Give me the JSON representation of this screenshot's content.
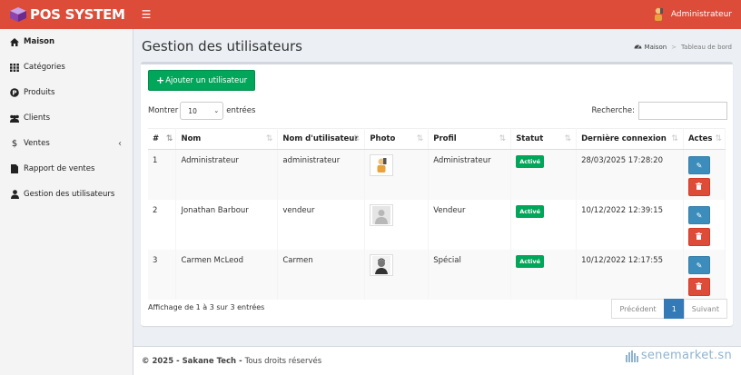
{
  "app": {
    "logo_text": "POS SYSTEM",
    "user_name": "Administrateur"
  },
  "sidebar": {
    "items": [
      {
        "label": "Maison",
        "icon": "home-icon"
      },
      {
        "label": "Catégories",
        "icon": "grid-icon"
      },
      {
        "label": "Produits",
        "icon": "product-hunt-icon"
      },
      {
        "label": "Clients",
        "icon": "users-icon"
      },
      {
        "label": "Ventes",
        "icon": "dollar-icon"
      },
      {
        "label": "Rapport de ventes",
        "icon": "file-icon"
      },
      {
        "label": "Gestion des utilisateurs",
        "icon": "user-icon"
      }
    ]
  },
  "page": {
    "title": "Gestion des utilisateurs",
    "breadcrumb": {
      "home": "Maison",
      "current": "Tableau de bord"
    }
  },
  "toolbar": {
    "add_label": "Ajouter un utilisateur"
  },
  "table_controls": {
    "show_label": "Montrer",
    "length_value": "10",
    "entries_label": "entrées",
    "search_label": "Recherche:",
    "search_value": ""
  },
  "table": {
    "headers": [
      "#",
      "Nom",
      "Nom d'utilisateur",
      "Photo",
      "Profil",
      "Statut",
      "Dernière connexion",
      "Actes"
    ],
    "rows": [
      {
        "num": "1",
        "name": "Administrateur",
        "username": "administrateur",
        "photo": "user-avatar-icon",
        "profile": "Administrateur",
        "status": "Activé",
        "last_login": "28/03/2025 17:28:20"
      },
      {
        "num": "2",
        "name": "Jonathan Barbour",
        "username": "vendeur",
        "photo": "default-avatar-icon",
        "profile": "Vendeur",
        "status": "Activé",
        "last_login": "10/12/2022 12:39:15"
      },
      {
        "num": "3",
        "name": "Carmen McLeod",
        "username": "Carmen",
        "photo": "user-photo-icon",
        "profile": "Spécial",
        "status": "Activé",
        "last_login": "10/12/2022 12:17:55"
      }
    ]
  },
  "footer_info": {
    "text": "Affichage de 1 à 3 sur 3 entrées"
  },
  "pagination": {
    "prev": "Précédent",
    "current": "1",
    "next": "Suivant"
  },
  "footer": {
    "copyright": "© 2025 - Sakane Tech -",
    "rights": "Tous droits réservés"
  },
  "watermark": {
    "text": "senemarket.sn"
  },
  "colors": {
    "header": "#dd4b39",
    "success": "#00a65a",
    "primary": "#3c8dbc",
    "danger": "#dd4b39"
  }
}
